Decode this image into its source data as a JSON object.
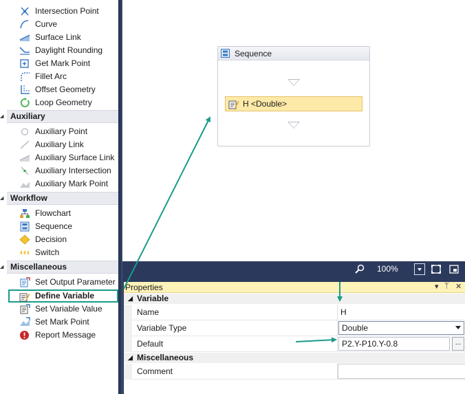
{
  "toolbox": {
    "categories": [
      {
        "label": "Auxiliary"
      },
      {
        "label": "Workflow"
      },
      {
        "label": "Miscellaneous"
      }
    ],
    "geometry_items": [
      {
        "label": "Intersection Point",
        "icon": "intersection-point-icon"
      },
      {
        "label": "Curve",
        "icon": "curve-icon"
      },
      {
        "label": "Surface Link",
        "icon": "surface-link-icon"
      },
      {
        "label": "Daylight Rounding",
        "icon": "daylight-rounding-icon"
      },
      {
        "label": "Get Mark Point",
        "icon": "get-mark-point-icon"
      },
      {
        "label": "Fillet Arc",
        "icon": "fillet-arc-icon"
      },
      {
        "label": "Offset Geometry",
        "icon": "offset-geometry-icon"
      },
      {
        "label": "Loop Geometry",
        "icon": "loop-geometry-icon"
      }
    ],
    "auxiliary_items": [
      {
        "label": "Auxiliary Point",
        "icon": "auxiliary-point-icon"
      },
      {
        "label": "Auxiliary Link",
        "icon": "auxiliary-link-icon"
      },
      {
        "label": "Auxiliary Surface Link",
        "icon": "auxiliary-surface-link-icon"
      },
      {
        "label": "Auxiliary Intersection",
        "icon": "auxiliary-intersection-icon"
      },
      {
        "label": "Auxiliary Mark Point",
        "icon": "auxiliary-mark-point-icon"
      }
    ],
    "workflow_items": [
      {
        "label": "Flowchart",
        "icon": "flowchart-icon"
      },
      {
        "label": "Sequence",
        "icon": "sequence-icon"
      },
      {
        "label": "Decision",
        "icon": "decision-icon"
      },
      {
        "label": "Switch",
        "icon": "switch-icon"
      }
    ],
    "misc_items": [
      {
        "label": "Set Output Parameter",
        "icon": "set-output-parameter-icon"
      },
      {
        "label": "Define Variable",
        "icon": "define-variable-icon",
        "selected": true
      },
      {
        "label": "Set Variable Value",
        "icon": "set-variable-value-icon"
      },
      {
        "label": "Set Mark Point",
        "icon": "set-mark-point-icon"
      },
      {
        "label": "Report Message",
        "icon": "report-message-icon"
      }
    ]
  },
  "designer": {
    "sequence_title": "Sequence",
    "activity_label": "H <Double>"
  },
  "zoombar": {
    "zoom": "100%"
  },
  "properties": {
    "title": "Properties",
    "title_buttons": [
      "▾",
      "ᛘ",
      "✕"
    ],
    "categories": [
      {
        "label": "Variable"
      },
      {
        "label": "Miscellaneous"
      }
    ],
    "rows": {
      "name": {
        "label": "Name",
        "value": "H"
      },
      "variable_type": {
        "label": "Variable Type",
        "value": "Double"
      },
      "default": {
        "label": "Default",
        "value": "P2.Y-P10.Y-0.8"
      },
      "comment": {
        "label": "Comment",
        "value": ""
      }
    },
    "ellipsis": "..."
  },
  "colors": {
    "accent_teal": "#1b9a8a",
    "dark_chrome": "#2b3a5c",
    "activity_fill": "#fde9a8",
    "props_title": "#fdf2b8"
  }
}
